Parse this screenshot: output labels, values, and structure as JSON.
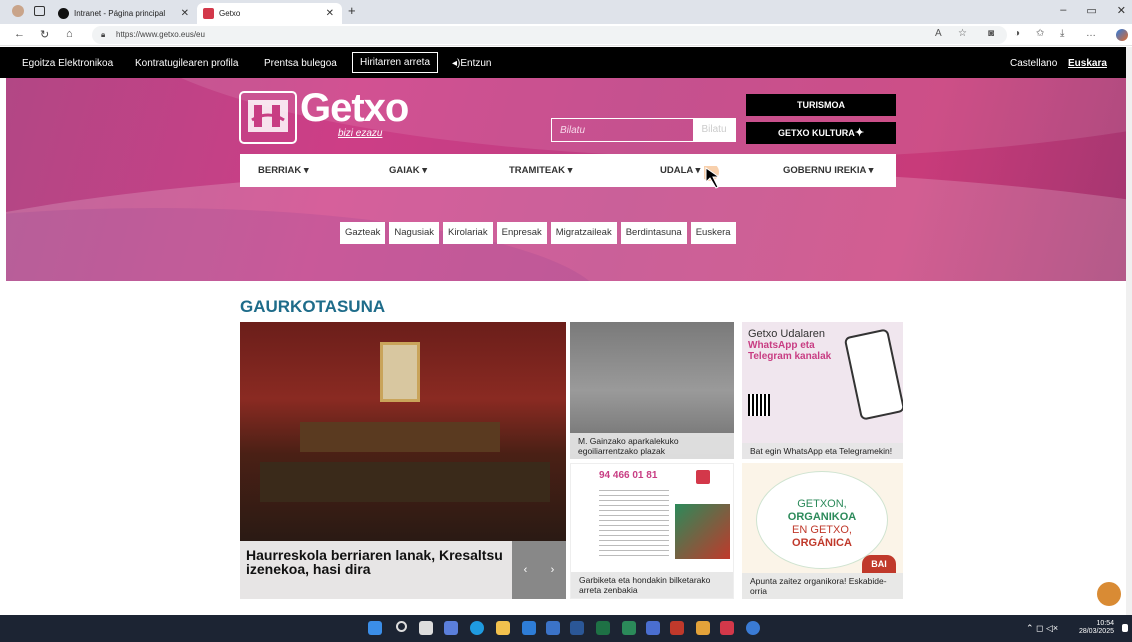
{
  "browser": {
    "tabs": [
      {
        "title": "Intranet - Página principal",
        "active": false
      },
      {
        "title": "Getxo",
        "active": true
      }
    ],
    "url": "https://www.getxo.eus/eu",
    "new_tab": "+"
  },
  "topbar": {
    "links": [
      "Egoitza Elektronikoa",
      "Kontratugilearen profila",
      "Prentsa bulegoa"
    ],
    "button": "Hiritarren arreta",
    "listen": "◂)Entzun",
    "lang_es": "Castellano",
    "lang_eu": "Euskara"
  },
  "header": {
    "logo_text": "Getxo",
    "logo_tagline": "bizi ezazu",
    "search_placeholder": "Bilatu",
    "search_button": "Bilatu",
    "turismoa": "TURISMOA",
    "kultura": "GETXO KULTURA"
  },
  "nav": [
    {
      "label": "BERRIAK ▾"
    },
    {
      "label": "GAIAK ▾"
    },
    {
      "label": "TRAMITEAK ▾"
    },
    {
      "label": "UDALA ▾"
    },
    {
      "label": "GOBERNU IREKIA ▾"
    }
  ],
  "tags": [
    "Gazteak",
    "Nagusiak",
    "Kirolariak",
    "Enpresak",
    "Migratzaileak",
    "Berdintasuna",
    "Euskera"
  ],
  "news": {
    "title": "GAURKOTASUNA",
    "main": "Haurreskola berriaren lanak, Kresaltsu izenekoa, hasi dira",
    "cards": [
      {
        "caption": "M. Gainzako aparkalekuko egoiliarrentzako plazak"
      },
      {
        "caption": "Bat egin WhatsApp eta Telegramekin!",
        "img_title": "Getxo Udalaren",
        "img_sub": "WhatsApp eta Telegram kanalak"
      },
      {
        "caption": "Garbiketa eta hondakin bilketarako arreta zenbakia",
        "phone": "94 466 01 81"
      },
      {
        "caption": "Apunta zaitez organikora! Eskabide-orria",
        "l1": "GETXON,",
        "l2": "ORGANIKOA",
        "l3": "EN GETXO,",
        "l4": "ORGÁNICA",
        "bai": "BAI"
      }
    ]
  },
  "taskbar": {
    "time": "10:54",
    "date": "28/03/2025"
  },
  "colors": {
    "hero": "#c83d83",
    "title": "#1e6c8a"
  }
}
